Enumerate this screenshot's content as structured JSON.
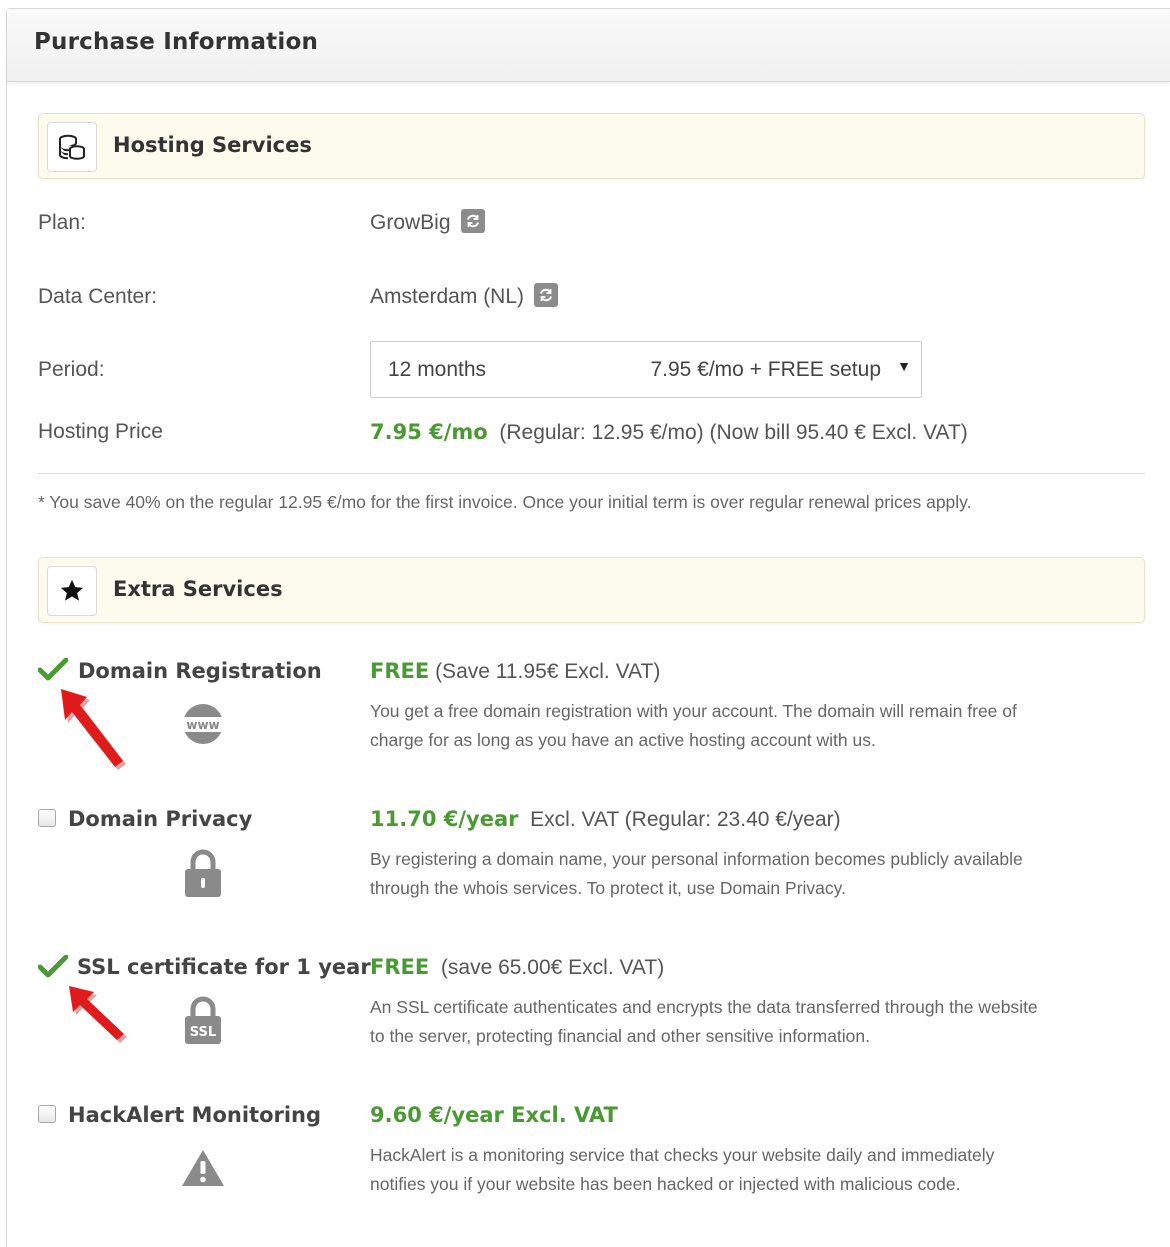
{
  "header": {
    "title": "Purchase Information"
  },
  "hosting": {
    "title": "Hosting Services",
    "icon": "coins-stack-icon",
    "plan_label": "Plan:",
    "plan_value": "GrowBig",
    "datacenter_label": "Data Center:",
    "datacenter_value": "Amsterdam (NL)",
    "period_label": "Period:",
    "period_select": {
      "term": "12 months",
      "price": "7.95 €/mo + FREE setup",
      "arrow": "▼"
    },
    "price_label": "Hosting Price",
    "price_value": "7.95 €/mo",
    "price_detail": "(Regular: 12.95 €/mo) (Now bill 95.40 € Excl. VAT)",
    "note": "* You save 40% on the regular 12.95 €/mo for the first invoice. Once your initial term is over regular renewal prices apply."
  },
  "extras": {
    "title": "Extra Services",
    "icon": "star-icon",
    "items": [
      {
        "name": "Domain Registration",
        "checked": true,
        "price": "FREE",
        "price_detail": "(Save 11.95€ Excl. VAT)",
        "desc_line1": "You get a free domain registration with your account. The domain will remain free of",
        "desc_line2": "charge for as long as you have an active hosting account with us.",
        "icon": "www-globe-icon"
      },
      {
        "name": "Domain Privacy",
        "checked": false,
        "price": "11.70 €/year",
        "price_detail": "Excl. VAT (Regular: 23.40 €/year)",
        "desc_line1": "By registering a domain name, your personal information becomes publicly available",
        "desc_line2": "through the whois services. To protect it, use Domain Privacy.",
        "icon": "padlock-icon"
      },
      {
        "name": "SSL certificate for 1 year",
        "checked": true,
        "price": "FREE",
        "price_detail": "(save 65.00€ Excl. VAT)",
        "desc_line1": "An SSL certificate authenticates and encrypts the data transferred through the website",
        "desc_line2": "to the server, protecting financial and other sensitive information.",
        "icon": "ssl-lock-icon",
        "icon_text": "SSL"
      },
      {
        "name": "HackAlert Monitoring",
        "checked": false,
        "price": "9.60 €/year Excl. VAT",
        "price_detail": "",
        "desc_line1": "HackAlert is a monitoring service that checks your website daily and immediately",
        "desc_line2": "notifies you if your website has been hacked or injected with malicious code.",
        "icon": "warning-triangle-icon"
      }
    ]
  },
  "colors": {
    "green": "#4a9a34",
    "section_bg": "#fcfbee",
    "arrow_red": "#e01b1b"
  },
  "icons": {
    "change": "refresh-icon",
    "annotation": "red-arrow-annotation"
  }
}
